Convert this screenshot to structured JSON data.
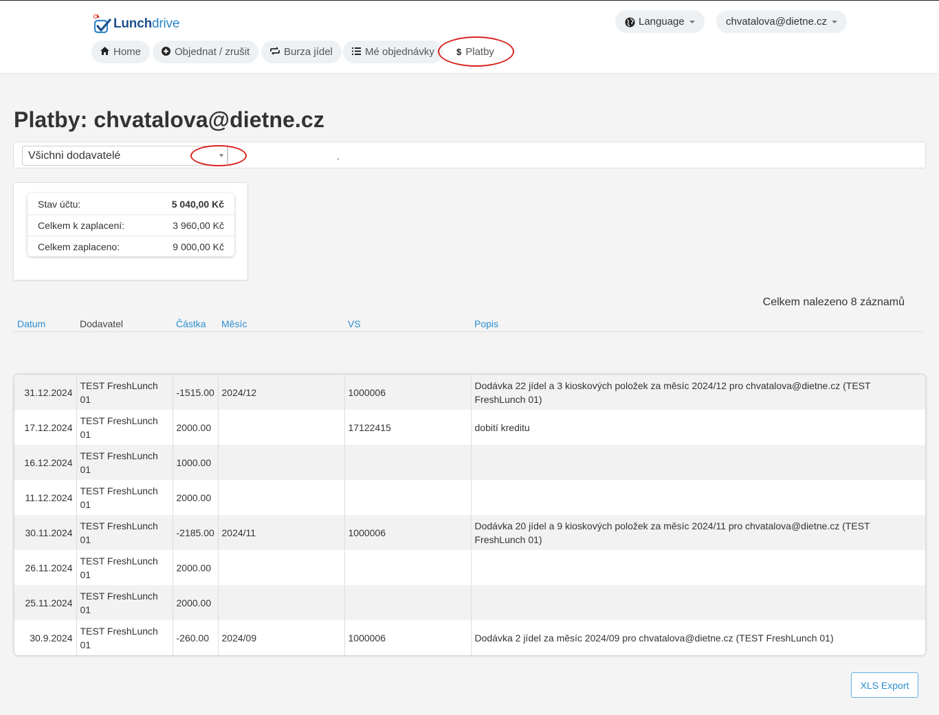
{
  "app": {
    "name_part1": "Lunch",
    "name_part2": "drive"
  },
  "header": {
    "language_label": "Language",
    "user_email": "chvatalova@dietne.cz"
  },
  "nav": {
    "items": [
      {
        "label": "Home",
        "icon": "home-icon"
      },
      {
        "label": "Objednat / zrušit",
        "icon": "plus-circle-icon"
      },
      {
        "label": "Burza jídel",
        "icon": "exchange-icon"
      },
      {
        "label": "Mé objednávky",
        "icon": "list-icon"
      },
      {
        "label": "Platby",
        "icon": "dollar-icon",
        "active": true
      }
    ]
  },
  "page": {
    "title": "Platby: chvatalova@dietne.cz"
  },
  "filter": {
    "supplier_selected": "Všichni dodavatelé",
    "dot": "."
  },
  "summary": {
    "rows": [
      {
        "label": "Stav účtu:",
        "value": "5 040,00 Kč"
      },
      {
        "label": "Celkem k zaplacení:",
        "value": "3 960,00 Kč"
      },
      {
        "label": "Celkem zaplaceno:",
        "value": "9 000,00 Kč"
      }
    ]
  },
  "table": {
    "found_text": "Celkem nalezeno 8 záznamů",
    "headers": {
      "date": "Datum",
      "supplier": "Dodavatel",
      "amount": "Částka",
      "month": "Měsíc",
      "vs": "VS",
      "description": "Popis"
    },
    "rows": [
      {
        "date": "31.12.2024",
        "supplier": "TEST FreshLunch 01",
        "amount": "-1515.00",
        "month": "2024/12",
        "vs": "1000006",
        "description": "Dodávka 22 jídel a 3 kioskových položek za měsíc 2024/12 pro chvatalova@dietne.cz (TEST FreshLunch 01)"
      },
      {
        "date": "17.12.2024",
        "supplier": "TEST FreshLunch 01",
        "amount": "2000.00",
        "month": "",
        "vs": "17122415",
        "description": "dobití kreditu"
      },
      {
        "date": "16.12.2024",
        "supplier": "TEST FreshLunch 01",
        "amount": "1000.00",
        "month": "",
        "vs": "",
        "description": ""
      },
      {
        "date": "11.12.2024",
        "supplier": "TEST FreshLunch 01",
        "amount": "2000.00",
        "month": "",
        "vs": "",
        "description": ""
      },
      {
        "date": "30.11.2024",
        "supplier": "TEST FreshLunch 01",
        "amount": "-2185.00",
        "month": "2024/11",
        "vs": "1000006",
        "description": "Dodávka 20 jídel a 9 kioskových položek za měsíc 2024/11 pro chvatalova@dietne.cz (TEST FreshLunch 01)"
      },
      {
        "date": "26.11.2024",
        "supplier": "TEST FreshLunch 01",
        "amount": "2000.00",
        "month": "",
        "vs": "",
        "description": ""
      },
      {
        "date": "25.11.2024",
        "supplier": "TEST FreshLunch 01",
        "amount": "2000.00",
        "month": "",
        "vs": "",
        "description": ""
      },
      {
        "date": "30.9.2024",
        "supplier": "TEST FreshLunch 01",
        "amount": "-260.00",
        "month": "2024/09",
        "vs": "1000006",
        "description": "Dodávka 2 jídel za měsíc 2024/09 pro chvatalova@dietne.cz (TEST FreshLunch 01)"
      }
    ]
  },
  "export": {
    "label": "XLS Export"
  },
  "colors": {
    "link": "#2a8fd0",
    "highlight": "#d9231d",
    "logo": "#1d4f8c"
  }
}
